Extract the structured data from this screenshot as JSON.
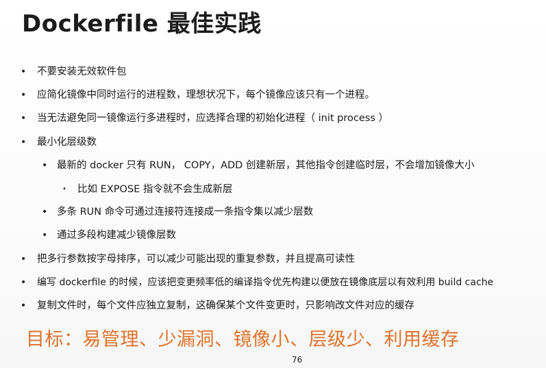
{
  "slide": {
    "title": "Dockerfile 最佳实践",
    "bullet_glyph": "•",
    "sub_bullet_glyph": "•",
    "small_bullet_glyph": "•",
    "bullets": [
      {
        "level": 1,
        "text": "不要安装无效软件包"
      },
      {
        "level": 1,
        "text": "应简化镜像中同时运行的进程数，理想状况下，每个镜像应该只有一个进程。"
      },
      {
        "level": 1,
        "text": "当无法避免同一镜像运行多进程时，应选择合理的初始化进程（ init process ）"
      },
      {
        "level": 1,
        "text": "最小化层级数"
      },
      {
        "level": 2,
        "text": "最新的 docker 只有 RUN， COPY，ADD 创建新层，其他指令创建临时层，不会增加镜像大小"
      },
      {
        "level": 3,
        "text": "比如 EXPOSE 指令就不会生成新层"
      },
      {
        "level": 2,
        "text": "多条 RUN 命令可通过连接符连接成一条指令集以减少层数"
      },
      {
        "level": 2,
        "text": "通过多段构建减少镜像层数"
      },
      {
        "level": 1,
        "text": "把多行参数按字母排序，可以减少可能出现的重复参数，并且提高可读性"
      },
      {
        "level": 1,
        "text": "编写 dockerfile 的时候，应该把变更频率低的编译指令优先构建以便放在镜像底层以有效利用 build cache"
      },
      {
        "level": 1,
        "text": "复制文件时，每个文件应独立复制，这确保某个文件变更时，只影响改文件对应的缓存"
      }
    ],
    "goal": "目标：易管理、少漏洞、镜像小、层级少、利用缓存",
    "page_number": "76",
    "colors": {
      "title": "#1b1b1b",
      "text": "#1a1a1a",
      "goal": "#e0732a",
      "background": "#ffffff"
    }
  }
}
